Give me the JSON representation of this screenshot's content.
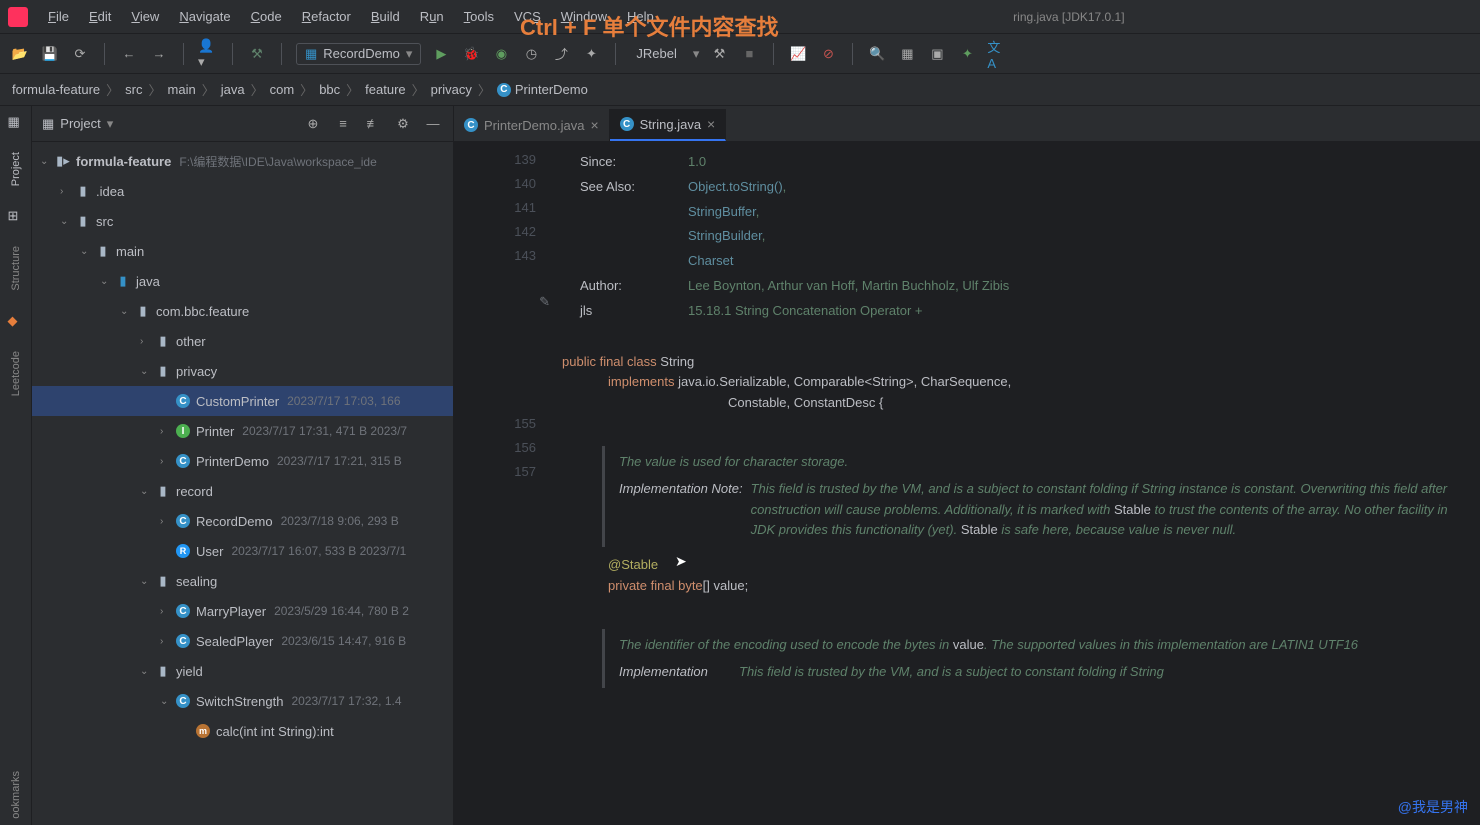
{
  "overlay": "Ctrl + F   单个文件内容查找",
  "title_suffix": "ring.java [JDK17.0.1]",
  "menu": [
    "File",
    "Edit",
    "View",
    "Navigate",
    "Code",
    "Refactor",
    "Build",
    "Run",
    "Tools",
    "VCS",
    "Window",
    "Help"
  ],
  "run_config": "RecordDemo",
  "jrebel_label": "JRebel",
  "breadcrumb": [
    "formula-feature",
    "src",
    "main",
    "java",
    "com",
    "bbc",
    "feature",
    "privacy",
    "PrinterDemo"
  ],
  "sidebar": {
    "title": "Project"
  },
  "left_tabs": [
    "Project",
    "Structure",
    "Leetcode",
    "ookmarks"
  ],
  "tree": {
    "root": "formula-feature",
    "root_path": "F:\\编程数据\\IDE\\Java\\workspace_ide",
    "nodes": [
      {
        "indent": 1,
        "arrow": "›",
        "icon": "folder",
        "label": ".idea"
      },
      {
        "indent": 1,
        "arrow": "⌄",
        "icon": "folder",
        "label": "src"
      },
      {
        "indent": 2,
        "arrow": "⌄",
        "icon": "folder",
        "label": "main"
      },
      {
        "indent": 3,
        "arrow": "⌄",
        "icon": "folder-blue",
        "label": "java"
      },
      {
        "indent": 4,
        "arrow": "⌄",
        "icon": "folder",
        "label": "com.bbc.feature"
      },
      {
        "indent": 5,
        "arrow": "›",
        "icon": "folder",
        "label": "other"
      },
      {
        "indent": 5,
        "arrow": "⌄",
        "icon": "folder",
        "label": "privacy"
      },
      {
        "indent": 6,
        "arrow": "",
        "icon": "c",
        "label": "CustomPrinter",
        "meta": "2023/7/17 17:03, 166",
        "selected": true
      },
      {
        "indent": 6,
        "arrow": "›",
        "icon": "i",
        "label": "Printer",
        "meta": "2023/7/17 17:31, 471 B 2023/7"
      },
      {
        "indent": 6,
        "arrow": "›",
        "icon": "c",
        "label": "PrinterDemo",
        "meta": "2023/7/17 17:21, 315 B"
      },
      {
        "indent": 5,
        "arrow": "⌄",
        "icon": "folder",
        "label": "record"
      },
      {
        "indent": 6,
        "arrow": "›",
        "icon": "c",
        "label": "RecordDemo",
        "meta": "2023/7/18 9:06, 293 B "
      },
      {
        "indent": 6,
        "arrow": "",
        "icon": "r",
        "label": "User",
        "meta": "2023/7/17 16:07, 533 B 2023/7/1"
      },
      {
        "indent": 5,
        "arrow": "⌄",
        "icon": "folder",
        "label": "sealing"
      },
      {
        "indent": 6,
        "arrow": "›",
        "icon": "c",
        "label": "MarryPlayer",
        "meta": "2023/5/29 16:44, 780 B 2"
      },
      {
        "indent": 6,
        "arrow": "›",
        "icon": "c",
        "label": "SealedPlayer",
        "meta": "2023/6/15 14:47, 916 B"
      },
      {
        "indent": 5,
        "arrow": "⌄",
        "icon": "folder",
        "label": "yield"
      },
      {
        "indent": 6,
        "arrow": "⌄",
        "icon": "c",
        "label": "SwitchStrength",
        "meta": "2023/7/17 17:32, 1.4"
      },
      {
        "indent": 7,
        "arrow": "",
        "icon": "m",
        "label": "calc(int int String):int"
      }
    ]
  },
  "tabs": [
    {
      "label": "PrinterDemo.java",
      "active": false
    },
    {
      "label": "String.java",
      "active": true
    }
  ],
  "doc": {
    "since_k": "Since:",
    "since_v": "1.0",
    "see_k": "See Also:",
    "see_links": [
      "Object.toString()",
      "StringBuffer",
      "StringBuilder",
      "Charset"
    ],
    "author_k": "Author:",
    "author_v": "Lee Boynton, Arthur van Hoff, Martin Buchholz, Ulf Zibis",
    "jls_k": "jls",
    "jls_v": "15.18.1 String Concatenation Operator +"
  },
  "gutter_lines": [
    "139",
    "140",
    "141",
    "142",
    "143",
    "",
    "",
    "",
    "",
    "",
    "",
    "155",
    "156",
    "157"
  ],
  "code": {
    "l1_a": "public final class ",
    "l1_b": "String",
    "l2_a": "implements ",
    "l2_b": "java.io.Serializable, Comparable<String>, CharSequence,",
    "l3": "Constable, ConstantDesc {",
    "doc1": "The value is used for character storage.",
    "impl_label": "Implementation Note:",
    "impl_body1": "This field is trusted by the VM, and is a subject to constant folding if String instance is constant. Overwriting this field after construction will cause problems. Additionally, it is marked with ",
    "stable1": "Stable",
    "impl_body2": " to trust the contents of the array. No other facility in JDK provides this functionality (yet). ",
    "stable2": "Stable",
    "impl_body3": " is safe here, because value is never null.",
    "ann": "@Stable",
    "priv": "private final ",
    "type": "byte",
    "arr": "[] ",
    "var": "value",
    "doc2a": "The identifier of the encoding used to encode the bytes in ",
    "doc2code": "value",
    "doc2b": ". The supported values in this implementation are LATIN1 UTF16",
    "impl2_body": "This field is trusted by the VM, and is a subject to constant folding if String"
  },
  "watermark": "@我是男神"
}
